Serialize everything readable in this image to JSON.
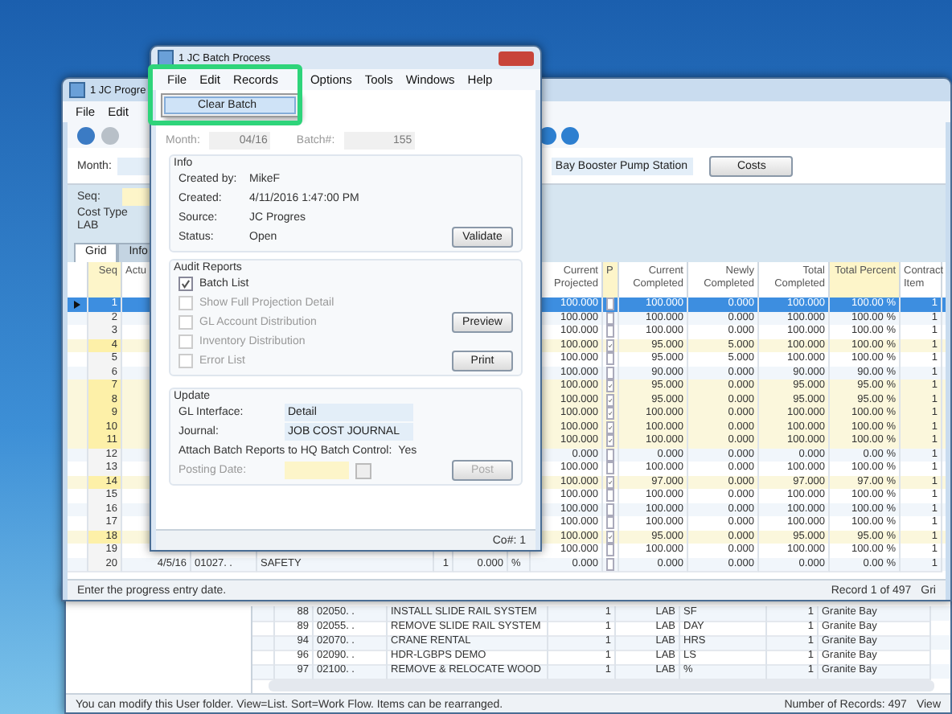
{
  "background_window": {
    "rows": [
      {
        "seq": "88",
        "code": "02050. .",
        "description": "INSTALL SLIDE RAIL SYSTEM",
        "qty": "1",
        "cost_type": "LAB",
        "um": "SF",
        "item": "1",
        "location": "Granite Bay"
      },
      {
        "seq": "89",
        "code": "02055. .",
        "description": "REMOVE SLIDE RAIL SYSTEM",
        "qty": "1",
        "cost_type": "LAB",
        "um": "DAY",
        "item": "1",
        "location": "Granite Bay"
      },
      {
        "seq": "94",
        "code": "02070. .",
        "description": "CRANE RENTAL",
        "qty": "1",
        "cost_type": "LAB",
        "um": "HRS",
        "item": "1",
        "location": "Granite Bay"
      },
      {
        "seq": "96",
        "code": "02090. .",
        "description": "HDR-LGBPS DEMO",
        "qty": "1",
        "cost_type": "LAB",
        "um": "LS",
        "item": "1",
        "location": "Granite Bay"
      },
      {
        "seq": "97",
        "code": "02100. .",
        "description": "REMOVE & RELOCATE WOOD",
        "qty": "1",
        "cost_type": "LAB",
        "um": "%",
        "item": "1",
        "location": "Granite Bay"
      }
    ],
    "status": "You can modify this User folder. View=List. Sort=Work Flow. Items can be rearranged.",
    "record_count": "Number of Records: 497",
    "status_right": "View"
  },
  "progress_window": {
    "title": "1 JC Progre",
    "menu": [
      "File",
      "Edit"
    ],
    "month_label": "Month:",
    "job_description": "Bay Booster Pump Station",
    "costs_button": "Costs",
    "seq_label": "Seq:",
    "cost_type_label": "Cost Type",
    "cost_type": "LAB",
    "tabs": [
      {
        "label": "Grid",
        "selected": true
      },
      {
        "label": "Info",
        "selected": false
      }
    ],
    "left_columns": [
      "Seq",
      "Actu"
    ],
    "right_columns": [
      "Current Projected",
      "P",
      "Current Completed",
      "Newly Completed",
      "Total Completed",
      "Total Percent",
      "Contract Item"
    ],
    "rows": [
      {
        "seq": "1",
        "selected": true,
        "p_checked": false,
        "values": [
          "100.000",
          "100.000",
          "0.000",
          "100.000",
          "100.00 %",
          "1"
        ]
      },
      {
        "seq": "2",
        "selected": false,
        "p_checked": false,
        "values": [
          "100.000",
          "100.000",
          "0.000",
          "100.000",
          "100.00 %",
          "1"
        ]
      },
      {
        "seq": "3",
        "selected": false,
        "p_checked": false,
        "values": [
          "100.000",
          "100.000",
          "0.000",
          "100.000",
          "100.00 %",
          "1"
        ]
      },
      {
        "seq": "4",
        "selected": false,
        "p_checked": true,
        "values": [
          "100.000",
          "95.000",
          "5.000",
          "100.000",
          "100.00 %",
          "1"
        ]
      },
      {
        "seq": "5",
        "selected": false,
        "p_checked": false,
        "values": [
          "100.000",
          "95.000",
          "5.000",
          "100.000",
          "100.00 %",
          "1"
        ]
      },
      {
        "seq": "6",
        "selected": false,
        "p_checked": false,
        "values": [
          "100.000",
          "90.000",
          "0.000",
          "90.000",
          "90.00 %",
          "1"
        ]
      },
      {
        "seq": "7",
        "selected": false,
        "p_checked": true,
        "values": [
          "100.000",
          "95.000",
          "0.000",
          "95.000",
          "95.00 %",
          "1"
        ]
      },
      {
        "seq": "8",
        "selected": false,
        "p_checked": true,
        "values": [
          "100.000",
          "95.000",
          "0.000",
          "95.000",
          "95.00 %",
          "1"
        ]
      },
      {
        "seq": "9",
        "selected": false,
        "p_checked": true,
        "values": [
          "100.000",
          "100.000",
          "0.000",
          "100.000",
          "100.00 %",
          "1"
        ]
      },
      {
        "seq": "10",
        "selected": false,
        "p_checked": true,
        "values": [
          "100.000",
          "100.000",
          "0.000",
          "100.000",
          "100.00 %",
          "1"
        ]
      },
      {
        "seq": "11",
        "selected": false,
        "p_checked": true,
        "values": [
          "100.000",
          "100.000",
          "0.000",
          "100.000",
          "100.00 %",
          "1"
        ]
      },
      {
        "seq": "12",
        "selected": false,
        "p_checked": false,
        "values": [
          "0.000",
          "0.000",
          "0.000",
          "0.000",
          "0.00 %",
          "1"
        ]
      },
      {
        "seq": "13",
        "selected": false,
        "p_checked": false,
        "values": [
          "100.000",
          "100.000",
          "0.000",
          "100.000",
          "100.00 %",
          "1"
        ]
      },
      {
        "seq": "14",
        "selected": false,
        "p_checked": true,
        "values": [
          "100.000",
          "97.000",
          "0.000",
          "97.000",
          "97.00 %",
          "1"
        ]
      },
      {
        "seq": "15",
        "selected": false,
        "p_checked": false,
        "values": [
          "100.000",
          "100.000",
          "0.000",
          "100.000",
          "100.00 %",
          "1"
        ]
      },
      {
        "seq": "16",
        "selected": false,
        "p_checked": false,
        "values": [
          "100.000",
          "100.000",
          "0.000",
          "100.000",
          "100.00 %",
          "1"
        ]
      },
      {
        "seq": "17",
        "selected": false,
        "p_checked": false,
        "values": [
          "100.000",
          "100.000",
          "0.000",
          "100.000",
          "100.00 %",
          "1"
        ]
      },
      {
        "seq": "18",
        "selected": false,
        "p_checked": true,
        "values": [
          "100.000",
          "95.000",
          "0.000",
          "95.000",
          "95.00 %",
          "1"
        ]
      },
      {
        "seq": "19",
        "selected": false,
        "p_checked": false,
        "values": [
          "100.000",
          "100.000",
          "0.000",
          "100.000",
          "100.00 %",
          "1"
        ]
      },
      {
        "seq": "20",
        "selected": false,
        "p_checked": false,
        "left_cells": [
          "4/5/16",
          "01027. .",
          "SAFETY",
          "1",
          "0.000",
          "%"
        ],
        "values": [
          "0.000",
          "0.000",
          "0.000",
          "0.000",
          "0.00 %",
          "1"
        ]
      }
    ],
    "status": "Enter the progress entry date.",
    "record": "Record 1 of 497",
    "status_right": "Gri"
  },
  "batch_dialog": {
    "title": "1 JC Batch Process",
    "menu": [
      "File",
      "Edit",
      "Records",
      "Options",
      "Tools",
      "Windows",
      "Help"
    ],
    "file_menu": [
      {
        "label": "Clear Batch",
        "selected": true
      }
    ],
    "month_label": "Month:",
    "month": "04/16",
    "batch_label": "Batch#:",
    "batch": "155",
    "info": {
      "title": "Info",
      "fields": [
        {
          "label": "Created by:",
          "value": "MikeF"
        },
        {
          "label": "Created:",
          "value": "4/11/2016 1:47:00 PM"
        },
        {
          "label": "Source:",
          "value": "JC Progres"
        },
        {
          "label": "Status:",
          "value": "Open"
        }
      ],
      "validate_button": "Validate"
    },
    "audit_reports": {
      "title": "Audit Reports",
      "options": [
        {
          "label": "Batch List",
          "checked": true,
          "disabled": false
        },
        {
          "label": "Show Full Projection Detail",
          "checked": false,
          "disabled": true
        },
        {
          "label": "GL Account Distribution",
          "checked": false,
          "disabled": true
        },
        {
          "label": "Inventory Distribution",
          "checked": false,
          "disabled": true
        },
        {
          "label": "Error List",
          "checked": false,
          "disabled": true
        }
      ],
      "preview_button": "Preview",
      "print_button": "Print"
    },
    "update": {
      "title": "Update",
      "gl_interface_label": "GL Interface:",
      "gl_interface": "Detail",
      "journal_label": "Journal:",
      "journal": "JOB COST JOURNAL",
      "attach_label": "Attach Batch Reports to HQ Batch Control:",
      "attach_value": "Yes",
      "posting_date_label": "Posting Date:",
      "post_button": "Post"
    },
    "status": "Co#: 1"
  }
}
